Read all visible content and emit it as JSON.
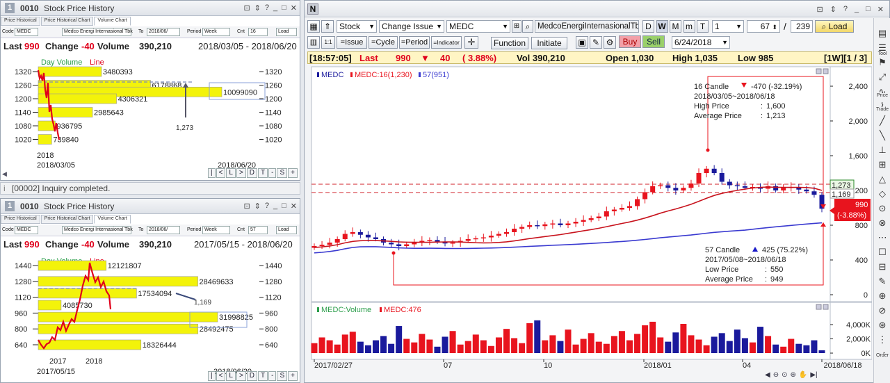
{
  "win_top": {
    "num": "1",
    "code": "0010",
    "title": "Stock Price History",
    "tabs": [
      "Price Historical",
      "Price Historical Chart",
      "Volume Chart"
    ],
    "ctrl": {
      "code_label": "Code",
      "code": "MEDC",
      "name": "Medco Energi Internasional Tbk",
      "to_label": "To",
      "to": "2018/06/",
      "period_label": "Period",
      "period": "Week",
      "cnt_label": "Cnt",
      "cnt": "16",
      "load": "Load"
    },
    "quote": {
      "last_label": "Last",
      "last": "990",
      "change_label": "Change",
      "change": "-40",
      "volume_label": "Volume",
      "volume": "390,210",
      "range": "2018/03/05 - 2018/06/20"
    },
    "legend_day_volume": "Day Volume",
    "legend_line": "Line",
    "y_ticks": [
      "1320",
      "1260",
      "1200",
      "1140",
      "1080",
      "1020"
    ],
    "bars": [
      {
        "level": 1320,
        "volume": 3480393,
        "label": "3480393"
      },
      {
        "level": 1260,
        "volume": 6178868,
        "label": "6178868"
      },
      {
        "level": 1230,
        "volume": 10099090,
        "label": "10099090"
      },
      {
        "level": 1200,
        "volume": 4306321,
        "label": "4306321"
      },
      {
        "level": 1140,
        "volume": 2985643,
        "label": "2985643"
      },
      {
        "level": 1080,
        "volume": 936795,
        "label": "936795"
      },
      {
        "level": 1020,
        "volume": 739840,
        "label": "739840"
      }
    ],
    "avg_label": "1,273",
    "x_year": "2018",
    "x_start": "2018/03/05",
    "x_end": "2018/06/20",
    "nav": [
      "|",
      "<",
      "L",
      ">",
      "D",
      "T",
      "-",
      "S",
      "+"
    ]
  },
  "status": {
    "text": "[00002] Inquiry completed."
  },
  "win_bottom": {
    "num": "1",
    "code": "0010",
    "title": "Stock Price History",
    "tabs": [
      "Price Historical",
      "Price Historical Chart",
      "Volume Chart"
    ],
    "ctrl": {
      "code_label": "Code",
      "code": "MEDC",
      "name": "Medco Energi Internasional Tbk",
      "to_label": "To",
      "to": "2018/06/",
      "period_label": "Period",
      "period": "Week",
      "cnt_label": "Cnt",
      "cnt": "57",
      "load": "Load"
    },
    "quote": {
      "last_label": "Last",
      "last": "990",
      "change_label": "Change",
      "change": "-40",
      "volume_label": "Volume",
      "volume": "390,210",
      "range": "2017/05/15 - 2018/06/20"
    },
    "legend_day_volume": "Day Volume",
    "legend_line": "Line",
    "y_ticks": [
      "1440",
      "1280",
      "1120",
      "960",
      "800",
      "640"
    ],
    "bars": [
      {
        "level": 1440,
        "volume": 12121807,
        "label": "12121807"
      },
      {
        "level": 1280,
        "volume": 28469633,
        "label": "28469633"
      },
      {
        "level": 1160,
        "volume": 17534094,
        "label": "17534094"
      },
      {
        "level": 1040,
        "volume": 4085730,
        "label": "4085730"
      },
      {
        "level": 920,
        "volume": 31998825,
        "label": "31998825"
      },
      {
        "level": 800,
        "volume": 28492475,
        "label": "28492475"
      },
      {
        "level": 640,
        "volume": 18326444,
        "label": "18326444"
      }
    ],
    "avg_label": "1,169",
    "x_year1": "2017",
    "x_year2": "2018",
    "x_start": "2017/05/15",
    "x_end": "2018/06/20",
    "nav": [
      "|",
      "<",
      "L",
      ">",
      "D",
      "T",
      "-",
      "S",
      "+"
    ]
  },
  "main": {
    "badge": "N",
    "market": "Stock",
    "mode": "Change Issue",
    "code": "MEDC",
    "name": "MedcoEnergiInternasionalTb",
    "periods": [
      "D",
      "W",
      "M",
      "m",
      "T"
    ],
    "active_period": "W",
    "interval": "1",
    "count": "67",
    "slash": "/",
    "total": "239",
    "load": "Load",
    "toolbar2": [
      "=Issue",
      "=Cycle",
      "=Period",
      "=Indicator"
    ],
    "function": "Function",
    "initiate": "Initiate",
    "buy": "Buy",
    "sell": "Sell",
    "date": "6/24/2018",
    "info": {
      "time": "[18:57:05]",
      "last_label": "Last",
      "last": "990",
      "change": "40",
      "pct": "( 3.88%)",
      "vol": "Vol 390,210",
      "open": "Open 1,030",
      "high": "High 1,035",
      "low": "Low 985",
      "page": "[1W][1 / 3]"
    },
    "legend": {
      "code": "MEDC",
      "ma16": "MEDC:16(1,230)",
      "ma57": "57(951)"
    },
    "y_ticks": [
      "2,400",
      "2,000",
      "1,600",
      "1,200",
      "800",
      "400",
      "0"
    ],
    "price_tags": {
      "p1": "1,273",
      "p2": "1,169",
      "last": "990",
      "pct": "(-3.88%)"
    },
    "box16": {
      "title": "16 Candle",
      "change": "-470 (-32.19%)",
      "range": "2018/03/05~2018/06/18",
      "high_label": "High Price",
      "high": "1,600",
      "avg_label": "Average Price",
      "avg": "1,213"
    },
    "box57": {
      "title": "57 Candle",
      "change": "425 (75.22%)",
      "range": "2017/05/08~2018/06/18",
      "low_label": "Low Price",
      "low": "550",
      "avg_label": "Average Price",
      "avg": "949"
    },
    "vol_legend": {
      "name": "MEDC:Volume",
      "ma": "MEDC:476"
    },
    "vol_ticks": [
      "4,000K",
      "2,000K",
      "0K"
    ],
    "x_labels": [
      "2017/02/27",
      "07",
      "10",
      "2018/01",
      "04",
      "2018/06/18"
    ],
    "right_tools": [
      "Tool",
      "Price",
      "Trade",
      "Order"
    ],
    "colors": {
      "up": "#e8141e",
      "down": "#1a1a9c",
      "ma16": "#c8141e",
      "ma57": "#3a3ad0",
      "bar": "#f3f30a"
    }
  }
}
